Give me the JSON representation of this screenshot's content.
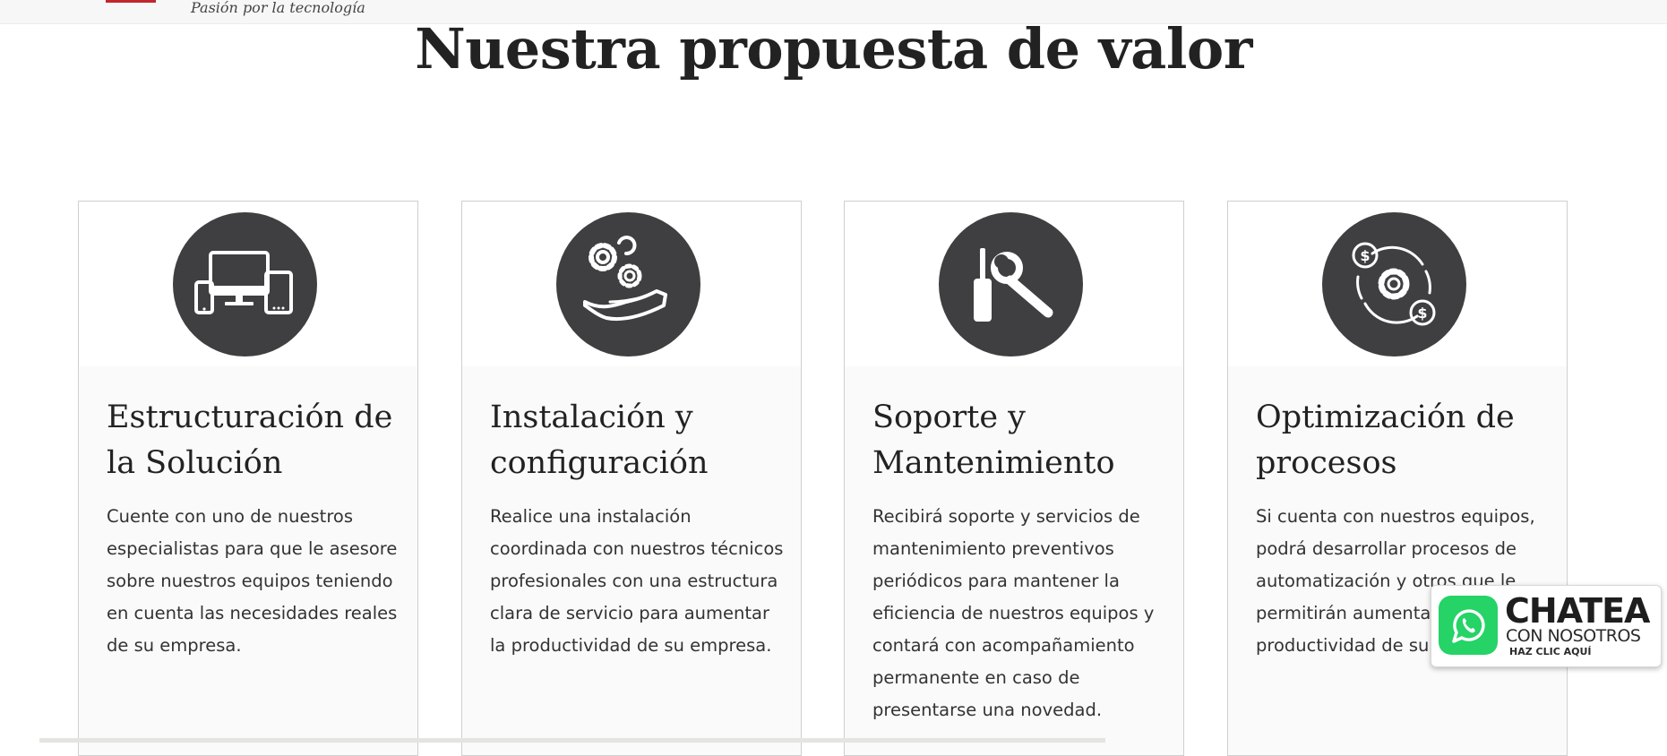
{
  "header": {
    "tagline": "Pasión por la tecnología",
    "brand_color": "#c0262d"
  },
  "section": {
    "title": "Nuestra propuesta de valor"
  },
  "cards": [
    {
      "icon": "devices-icon",
      "title": "Estructuración de la Solución",
      "text": "Cuente con uno de nuestros especialistas para que le asesore sobre nuestros equipos teniendo en cuenta las necesidades reales de su empresa."
    },
    {
      "icon": "gears-hand-icon",
      "title": "Instalación y configuración",
      "text": "Realice una instalación coordinada con nuestros técnicos profesionales con una estructura clara de servicio para aumentar la productividad de su empresa."
    },
    {
      "icon": "tools-icon",
      "title": "Soporte y Mantenimiento",
      "text": "Recibirá soporte y servicios de mantenimiento preventivos periódicos para mantener la eficiencia de nuestros equipos y contará con  acompañamiento permanente en caso de presentarse una novedad."
    },
    {
      "icon": "process-optimization-icon",
      "title": "Optimización de procesos",
      "text": "Si cuenta con nuestros equipos, podrá desarrollar procesos de automatización y otros que le permitirán aumentar la productividad de su empresa."
    }
  ],
  "chat_widget": {
    "icon": "whatsapp-icon",
    "main": "CHATEA",
    "sub": "CON NOSOTROS",
    "cta": "HAZ CLIC AQUÍ",
    "color": "#25d366"
  },
  "colors": {
    "icon_circle": "#3f3f41",
    "card_bg": "#fafafa",
    "heading": "#222222"
  }
}
